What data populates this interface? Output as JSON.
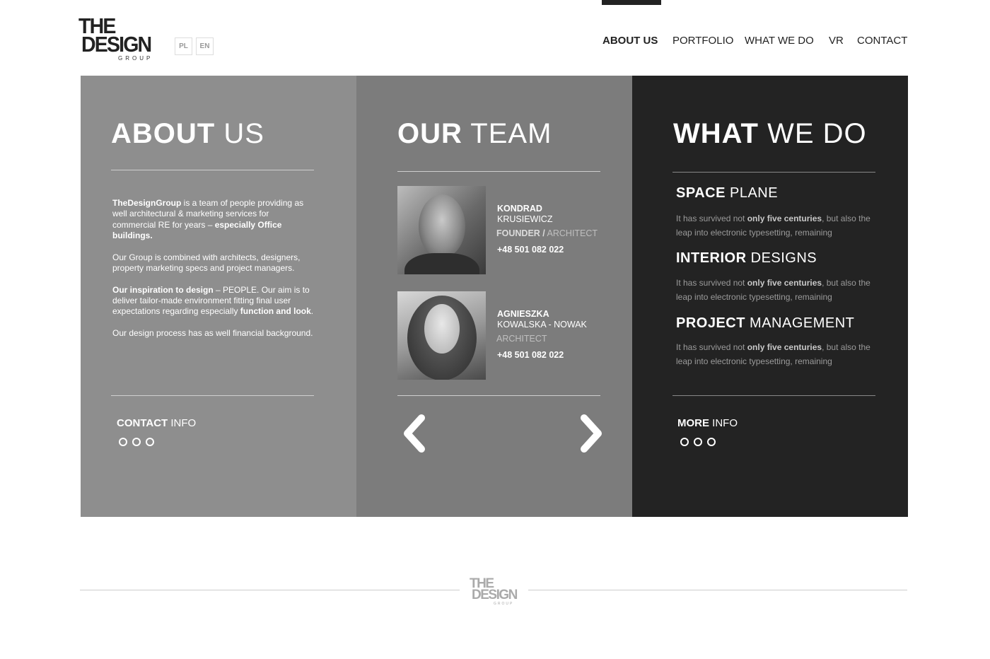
{
  "header": {
    "logo": {
      "line1": "THE",
      "line2": "DESIGN",
      "line3": "GROUP"
    },
    "languages": [
      "PL",
      "EN"
    ],
    "nav": [
      {
        "label": "ABOUT US",
        "active": true
      },
      {
        "label": "PORTFOLIO",
        "active": false
      },
      {
        "label": "WHAT WE DO",
        "active": false
      },
      {
        "label": "VR",
        "active": false
      },
      {
        "label": "CONTACT",
        "active": false
      }
    ]
  },
  "about": {
    "title_bold": "ABOUT",
    "title_light": "US",
    "p1_b1": "TheDesignGroup",
    "p1_t1": " is a team of people providing as well architectural & marketing services for commercial RE for years – ",
    "p1_b2": "especially Office buildings.",
    "p2": "Our Group is combined with architects, designers, property marketing specs and project managers.",
    "p3_b1": "Our inspiration to design",
    "p3_t1": " – PEOPLE. Our aim is to deliver tailor-made environment fitting final user expectations regarding especially ",
    "p3_b2": "function and look",
    "p3_t2": ".",
    "p4": "Our design process has as well financial background.",
    "footer_bold": "CONTACT",
    "footer_light": "INFO"
  },
  "team": {
    "title_bold": "OUR",
    "title_light": "TEAM",
    "members": [
      {
        "first": "KONDRAD",
        "last": "KRUSIEWICZ",
        "role_bold": "FOUNDER /",
        "role": " ARCHITECT",
        "phone": "+48 501 082 022"
      },
      {
        "first": "AGNIESZKA",
        "last": "KOWALSKA - NOWAK",
        "role_bold": "",
        "role": "ARCHITECT",
        "phone": "+48 501 082 022"
      }
    ]
  },
  "services": {
    "title_bold": "WHAT",
    "title_light": "WE DO",
    "items": [
      {
        "bold": "SPACE",
        "light": "PLANE",
        "t1": "It has survived not ",
        "b": "only five centuries",
        "t2": ", but also the leap into electronic typesetting, remaining"
      },
      {
        "bold": "INTERIOR",
        "light": "DESIGNS",
        "t1": "It has survived not ",
        "b": "only five centuries",
        "t2": ", but also the leap into electronic typesetting, remaining"
      },
      {
        "bold": "PROJECT",
        "light": "MANAGEMENT",
        "t1": "It has survived not ",
        "b": "only five centuries",
        "t2": ", but also the leap into electronic typesetting, remaining"
      }
    ],
    "footer_bold": "MORE",
    "footer_light": "INFO"
  },
  "footer": {
    "logo_line1": "THE",
    "logo_line2": "DESIGN",
    "logo_line3": "GROUP"
  },
  "colors": {
    "panel1": "#8e8e8e",
    "panel2": "#7c7c7c",
    "panel3": "#232323",
    "text_dark": "#222222"
  }
}
